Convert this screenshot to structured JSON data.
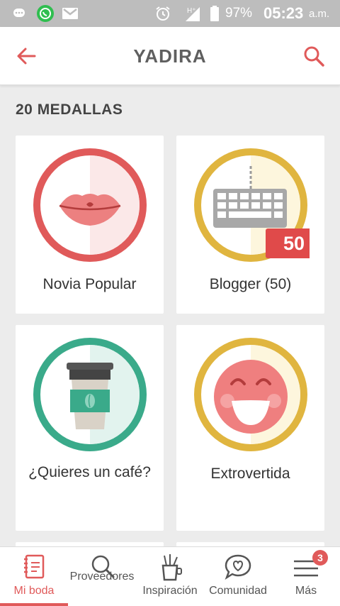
{
  "status_bar": {
    "battery_percent": "97%",
    "time": "05:23",
    "ampm": "a.m.",
    "icons": [
      "chat-bubble-icon",
      "whatsapp-icon",
      "gmail-icon",
      "alarm-icon",
      "signal-icon",
      "battery-icon"
    ]
  },
  "app_bar": {
    "title": "YADIRA",
    "back_icon": "arrow-left-icon",
    "search_icon": "search-icon"
  },
  "section": {
    "title": "20 MEDALLAS"
  },
  "medals": [
    {
      "label": "Novia Popular",
      "icon": "lips-icon",
      "ring_color": "#e05a5a"
    },
    {
      "label": "Blogger (50)",
      "icon": "keyboard-icon",
      "ring_color": "#e0b53f",
      "badge": "50"
    },
    {
      "label": "¿Quieres un café?",
      "icon": "coffee-cup-icon",
      "ring_color": "#3aaa8a"
    },
    {
      "label": "Extrovertida",
      "icon": "smiley-icon",
      "ring_color": "#e0b53f"
    }
  ],
  "bottom_nav": {
    "items": [
      {
        "label": "Mi boda",
        "icon": "notebook-icon",
        "active": true
      },
      {
        "label": "Proveedores",
        "icon": "search-icon"
      },
      {
        "label": "Inspiración",
        "icon": "pencil-cup-icon"
      },
      {
        "label": "Comunidad",
        "icon": "heart-chat-icon"
      },
      {
        "label": "Más",
        "icon": "menu-icon",
        "badge": "3"
      }
    ]
  },
  "colors": {
    "accent": "#e05a5a",
    "gold": "#e0b53f",
    "teal": "#3aaa8a",
    "status_bar": "#bdbdbd"
  }
}
